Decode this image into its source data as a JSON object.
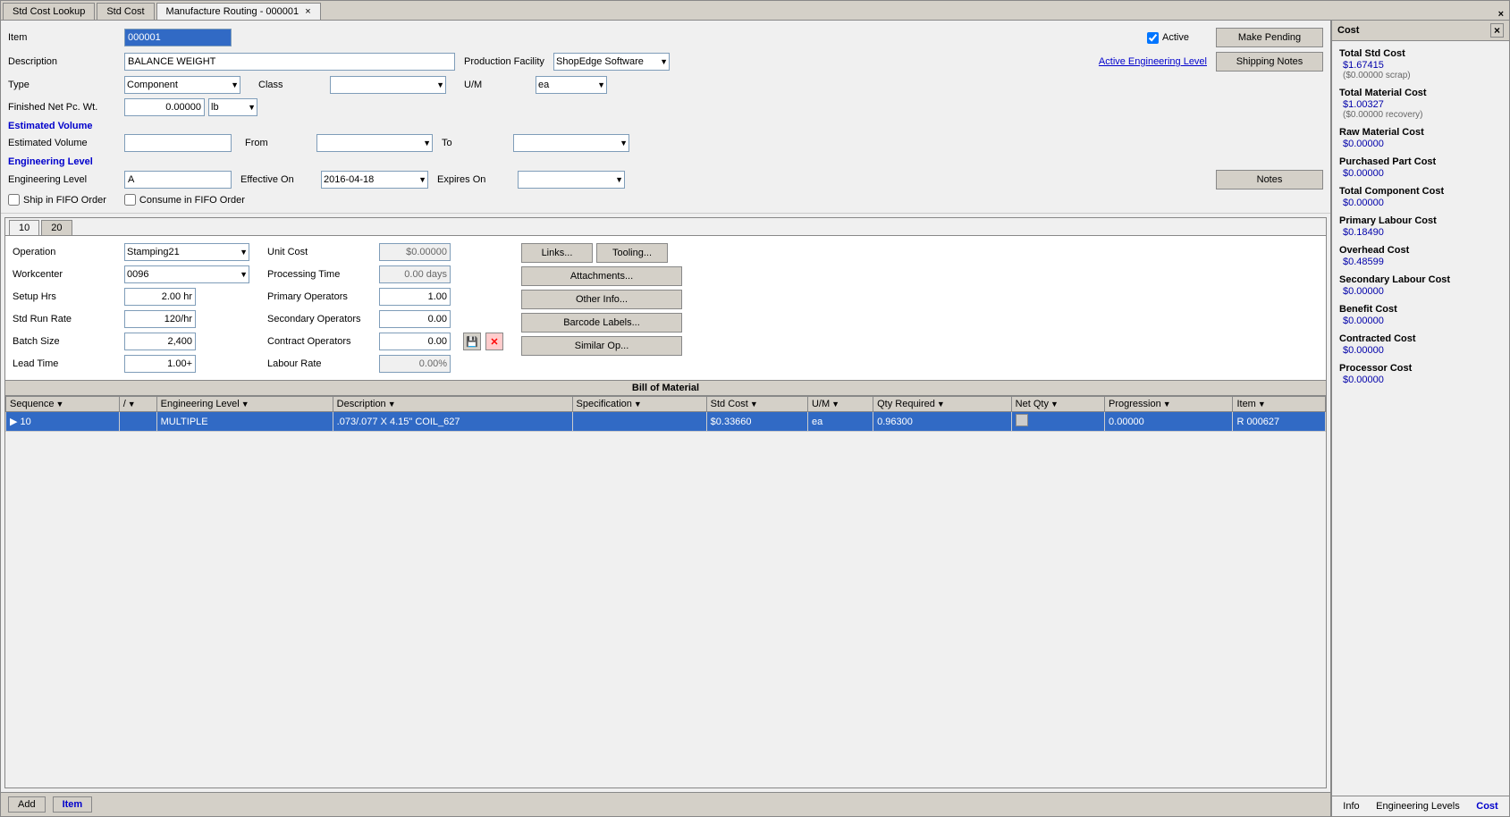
{
  "window": {
    "title": "Manufacture Routing - 000001",
    "close_btn": "×"
  },
  "tabs": [
    {
      "label": "Std Cost Lookup",
      "active": false
    },
    {
      "label": "Std Cost",
      "active": false
    },
    {
      "label": "Manufacture Routing - 000001",
      "active": true
    }
  ],
  "form": {
    "item_label": "Item",
    "item_value": "000001",
    "description_label": "Description",
    "description_value": "BALANCE WEIGHT",
    "production_facility_label": "Production Facility",
    "production_facility_value": "ShopEdge Software",
    "type_label": "Type",
    "type_value": "Component",
    "class_label": "Class",
    "class_value": "",
    "um_label": "U/M",
    "um_value": "ea",
    "finished_net_pc_wt_label": "Finished Net Pc. Wt.",
    "finished_net_pc_wt_value": "0.00000",
    "weight_unit": "lb",
    "active_label": "Active",
    "active_checked": true,
    "active_eng_level": "Active Engineering Level",
    "make_pending_btn": "Make Pending",
    "shipping_notes_btn": "Shipping Notes",
    "estimated_volume_section": "Estimated Volume",
    "estimated_volume_label": "Estimated Volume",
    "from_label": "From",
    "from_value": "",
    "to_label": "To",
    "to_value": "",
    "engineering_level_section": "Engineering Level",
    "engineering_level_label": "Engineering Level",
    "engineering_level_value": "A",
    "effective_on_label": "Effective On",
    "effective_on_value": "2016-04-18",
    "expires_on_label": "Expires On",
    "expires_on_value": "",
    "notes_btn": "Notes",
    "ship_fifo_label": "Ship in FIFO Order",
    "ship_fifo_checked": false,
    "consume_fifo_label": "Consume in FIFO Order",
    "consume_fifo_checked": false
  },
  "op_tabs": [
    {
      "label": "10",
      "active": true
    },
    {
      "label": "20",
      "active": false
    }
  ],
  "operations": {
    "operation_label": "Operation",
    "operation_value": "Stamping21",
    "workcenter_label": "Workcenter",
    "workcenter_value": "0096",
    "setup_hrs_label": "Setup Hrs",
    "setup_hrs_value": "2.00 hr",
    "std_run_rate_label": "Std Run Rate",
    "std_run_rate_value": "120/hr",
    "batch_size_label": "Batch Size",
    "batch_size_value": "2,400",
    "lead_time_label": "Lead Time",
    "lead_time_value": "1.00+",
    "unit_cost_label": "Unit Cost",
    "unit_cost_value": "$0.00000",
    "processing_time_label": "Processing Time",
    "processing_time_value": "0.00 days",
    "primary_operators_label": "Primary Operators",
    "primary_operators_value": "1.00",
    "secondary_operators_label": "Secondary Operators",
    "secondary_operators_value": "0.00",
    "contract_operators_label": "Contract Operators",
    "contract_operators_value": "0.00",
    "labour_rate_label": "Labour Rate",
    "labour_rate_value": "0.00%",
    "links_btn": "Links...",
    "tooling_btn": "Tooling...",
    "attachments_btn": "Attachments...",
    "other_info_btn": "Other Info...",
    "barcode_labels_btn": "Barcode Labels...",
    "similar_op_btn": "Similar Op..."
  },
  "bom": {
    "section_title": "Bill of Material",
    "columns": [
      {
        "label": "Sequence",
        "key": "sequence"
      },
      {
        "label": "/",
        "key": "slash"
      },
      {
        "label": "Engineering Level",
        "key": "engineering_level"
      },
      {
        "label": "Description",
        "key": "description"
      },
      {
        "label": "Specification",
        "key": "specification"
      },
      {
        "label": "Std Cost",
        "key": "std_cost"
      },
      {
        "label": "U/M",
        "key": "um"
      },
      {
        "label": "Qty Required",
        "key": "qty_required"
      },
      {
        "label": "Net Qty",
        "key": "net_qty"
      },
      {
        "label": "Progression",
        "key": "progression"
      },
      {
        "label": "Item",
        "key": "item"
      }
    ],
    "rows": [
      {
        "sequence": "10",
        "slash": "",
        "engineering_level": "MULTIPLE",
        "description": ".073/.077 X 4.15\" COIL_627",
        "specification": "",
        "std_cost": "$0.33660",
        "um": "ea",
        "qty_required": "0.96300",
        "net_qty": "",
        "progression": "0.00000",
        "item": "R 000627"
      }
    ]
  },
  "cost_panel": {
    "title": "Cost",
    "close_btn": "×",
    "total_std_cost_label": "Total Std Cost",
    "total_std_cost_value": "$1.67415",
    "total_std_cost_sub": "($0.00000 scrap)",
    "total_material_cost_label": "Total Material Cost",
    "total_material_cost_value": "$1.00327",
    "total_material_cost_sub": "($0.00000 recovery)",
    "raw_material_cost_label": "Raw Material Cost",
    "raw_material_cost_value": "$0.00000",
    "purchased_part_cost_label": "Purchased Part Cost",
    "purchased_part_cost_value": "$0.00000",
    "total_component_cost_label": "Total Component Cost",
    "total_component_cost_value": "$0.00000",
    "primary_labour_cost_label": "Primary Labour Cost",
    "primary_labour_cost_value": "$0.18490",
    "overhead_cost_label": "Overhead Cost",
    "overhead_cost_value": "$0.48599",
    "secondary_labour_cost_label": "Secondary Labour Cost",
    "secondary_labour_cost_value": "$0.00000",
    "benefit_cost_label": "Benefit Cost",
    "benefit_cost_value": "$0.00000",
    "contracted_cost_label": "Contracted Cost",
    "contracted_cost_value": "$0.00000",
    "processor_cost_label": "Processor Cost",
    "processor_cost_value": "$0.00000"
  },
  "bottom_nav": {
    "info_tab": "Info",
    "engineering_levels_tab": "Engineering Levels",
    "cost_tab": "Cost"
  },
  "bottom_bar": {
    "add_btn": "Add",
    "item_btn": "Item"
  },
  "icons": {
    "save": "💾",
    "delete": "✕",
    "arrow_right": "▶",
    "sort": "▼",
    "checkbox_checked": "☑",
    "checkbox_unchecked": "☐"
  }
}
